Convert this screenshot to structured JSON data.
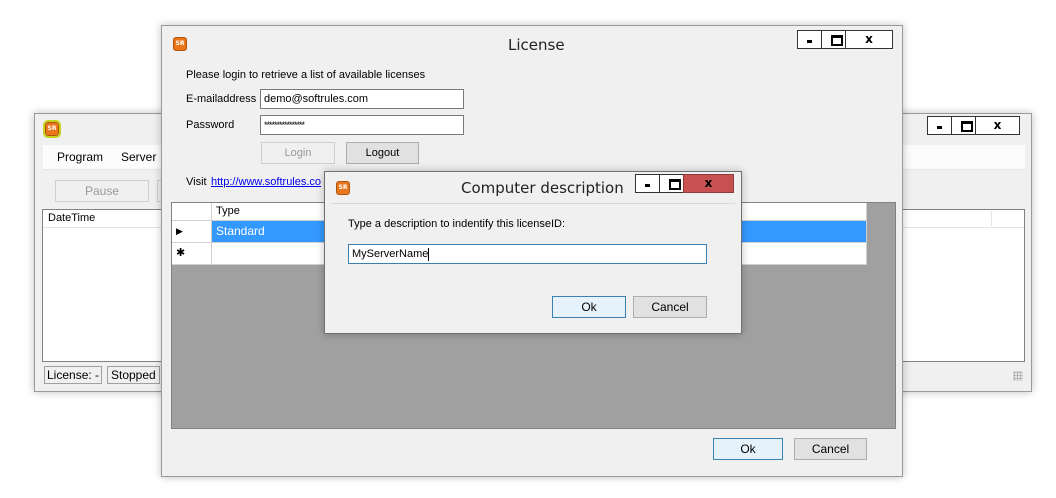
{
  "main_window": {
    "logo_text": "SR",
    "menu": [
      "Program",
      "Server"
    ],
    "pause_label": "Pause",
    "column_header": "DateTime",
    "status": {
      "license": "License: -",
      "state": "Stopped"
    }
  },
  "license_window": {
    "logo_text": "SR",
    "title": "License",
    "intro": "Please login to retrieve a list of available licenses",
    "email_label": "E-mailaddress",
    "email_value": "demo@softrules.com",
    "password_label": "Password",
    "password_value": "****************",
    "login_label": "Login",
    "logout_label": "Logout",
    "visit_label": "Visit",
    "visit_link": "http://www.softrules.co",
    "grid": {
      "column_header": "Type",
      "row_marker": "▶",
      "new_row_marker": "✱",
      "rows": [
        "Standard"
      ]
    },
    "ok_label": "Ok",
    "cancel_label": "Cancel"
  },
  "dialog": {
    "logo_text": "SR",
    "title": "Computer description",
    "prompt": "Type a description to indentify this licenseID:",
    "input_value": "MyServerName",
    "ok_label": "Ok",
    "cancel_label": "Cancel"
  },
  "controls": {
    "minimize_icon": "minimize-icon",
    "maximize_icon": "maximize-icon",
    "close_label": "x"
  },
  "colors": {
    "grid_background": "#a0a0a0",
    "selection": "#3399ff",
    "close_hover": "#c75050",
    "link": "#0000ee"
  }
}
